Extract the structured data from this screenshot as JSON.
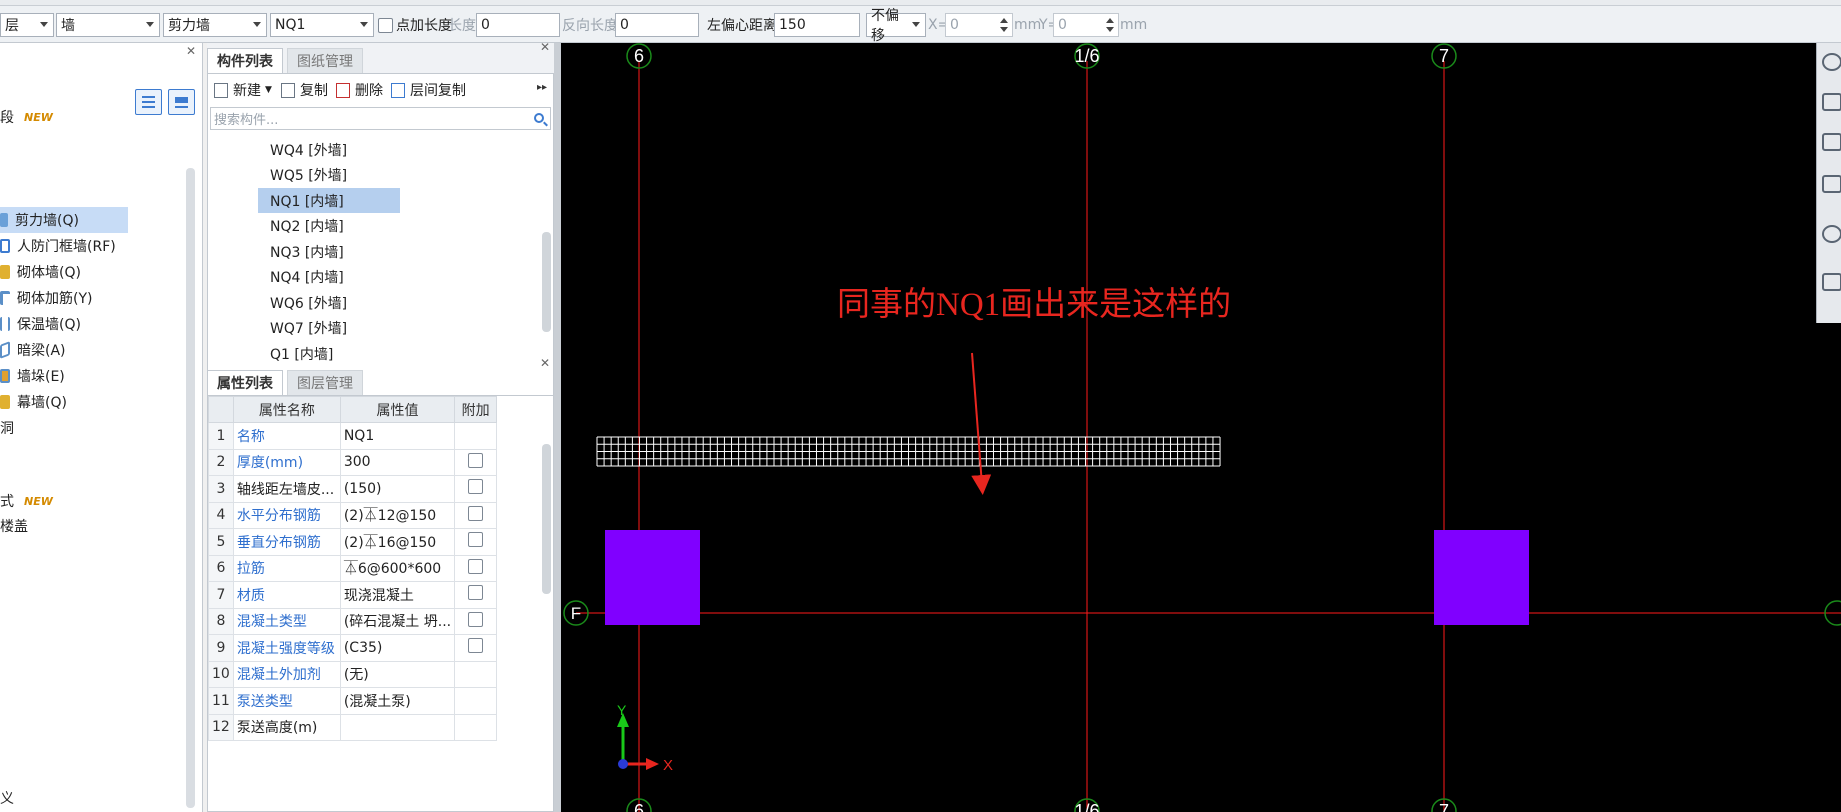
{
  "toolbar": {
    "floor_select": "层",
    "type_select": "墙",
    "subtype_select": "剪力墙",
    "component_select": "NQ1",
    "point_length_label": "点加长度",
    "length_label": "长度:",
    "length_value": "0",
    "reverse_length_label": "反向长度:",
    "reverse_length_value": "0",
    "left_offset_label": "左偏心距离:",
    "left_offset_value": "150",
    "offset_mode": "不偏移",
    "x_label": "X=",
    "x_value": "0",
    "x_unit": "mm",
    "y_label": "Y=",
    "y_value": "0",
    "y_unit": "mm"
  },
  "left_panel": {
    "items": [
      {
        "label": "段",
        "new": "NEW"
      },
      {
        "label": "剪力墙(Q)",
        "selected": true,
        "color": "#6aa0d8"
      },
      {
        "label": "人防门框墙(RF)",
        "color": "#3d7bd0"
      },
      {
        "label": "砌体墙(Q)",
        "color": "#e0b030"
      },
      {
        "label": "砌体加筋(Y)",
        "color": "#5b8fc7"
      },
      {
        "label": "保温墙(Q)",
        "color": "#5b8fc7"
      },
      {
        "label": "暗梁(A)",
        "color": "#5b8fc7"
      },
      {
        "label": "墙垛(E)",
        "color": "#e0a030"
      },
      {
        "label": "幕墙(Q)",
        "color": "#e0b030"
      },
      {
        "label": "洞"
      },
      {
        "label": "式",
        "new": "NEW"
      },
      {
        "label": "楼盖"
      },
      {
        "label": "义"
      }
    ]
  },
  "component_panel": {
    "tabs": [
      "构件列表",
      "图纸管理"
    ],
    "tools": {
      "new": "新建",
      "copy": "复制",
      "delete": "删除",
      "floor_copy": "层间复制"
    },
    "search_placeholder": "搜索构件...",
    "items": [
      "WQ4 [外墙]",
      "WQ5 [外墙]",
      "NQ1 [内墙]",
      "NQ2 [内墙]",
      "NQ3 [内墙]",
      "NQ4 [内墙]",
      "WQ6 [外墙]",
      "WQ7 [外墙]",
      "Q1 [内墙]"
    ],
    "selected_index": 2
  },
  "properties_panel": {
    "tabs": [
      "属性列表",
      "图层管理"
    ],
    "headers": [
      "属性名称",
      "属性值",
      "附加"
    ],
    "rows": [
      {
        "n": "1",
        "name": "名称",
        "value": "NQ1",
        "blue": true,
        "check": false
      },
      {
        "n": "2",
        "name": "厚度(mm)",
        "value": "300",
        "blue": true,
        "check": true
      },
      {
        "n": "3",
        "name": "轴线距左墙皮...",
        "value": "(150)",
        "blue": false,
        "check": true
      },
      {
        "n": "4",
        "name": "水平分布钢筋",
        "value": "(2)⏄12@150",
        "blue": true,
        "check": true
      },
      {
        "n": "5",
        "name": "垂直分布钢筋",
        "value": "(2)⏄16@150",
        "blue": true,
        "check": true
      },
      {
        "n": "6",
        "name": "拉筋",
        "value": "⏄6@600*600",
        "blue": true,
        "check": true
      },
      {
        "n": "7",
        "name": "材质",
        "value": "现浇混凝土",
        "blue": true,
        "check": true
      },
      {
        "n": "8",
        "name": "混凝土类型",
        "value": "(碎石混凝土 坍...",
        "blue": true,
        "check": true
      },
      {
        "n": "9",
        "name": "混凝土强度等级",
        "value": "(C35)",
        "blue": true,
        "check": true
      },
      {
        "n": "10",
        "name": "混凝土外加剂",
        "value": "(无)",
        "blue": true,
        "check": false
      },
      {
        "n": "11",
        "name": "泵送类型",
        "value": "(混凝土泵)",
        "blue": true,
        "check": false
      },
      {
        "n": "12",
        "name": "泵送高度(m)",
        "value": "",
        "blue": false,
        "check": false
      }
    ]
  },
  "canvas": {
    "axis_labels": {
      "left": "6",
      "middle": "1/6",
      "right": "7",
      "row": "F"
    },
    "annotation": "同事的NQ1画出来是这样的",
    "ucs_x": "X",
    "ucs_y": "Y",
    "colors": {
      "axis": "#ff1a1a",
      "column": "#8000ff",
      "mesh": "#ffffff",
      "annotation": "#e8261f",
      "bubble": "#1a8a1a"
    }
  }
}
